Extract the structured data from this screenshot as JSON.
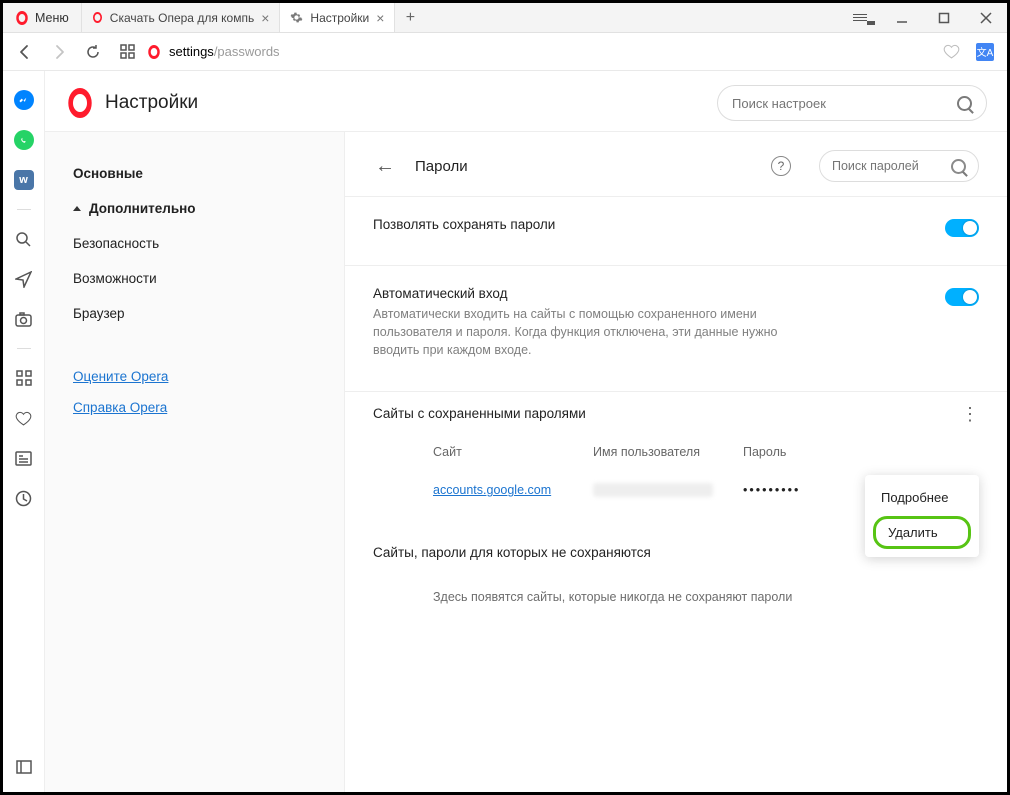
{
  "window": {
    "menu_label": "Меню",
    "tabs": [
      {
        "title": "Скачать Опера для компь",
        "active": false
      },
      {
        "title": "Настройки",
        "active": true
      }
    ]
  },
  "addressbar": {
    "prefix": "settings",
    "suffix": "/passwords"
  },
  "settings_header": {
    "title": "Настройки",
    "search_placeholder": "Поиск настроек"
  },
  "side_nav": {
    "basic": "Основные",
    "advanced": "Дополнительно",
    "security": "Безопасность",
    "features": "Возможности",
    "browser": "Браузер",
    "rate": "Оцените Opera",
    "help": "Справка Opera"
  },
  "content": {
    "page_title": "Пароли",
    "search_placeholder": "Поиск паролей",
    "allow_save_label": "Позволять сохранять пароли",
    "autosignin_title": "Автоматический вход",
    "autosignin_desc": "Автоматически входить на сайты с помощью сохраненного имени пользователя и пароля. Когда функция отключена, эти данные нужно вводить при каждом входе.",
    "saved_sites_heading": "Сайты с сохраненными паролями",
    "columns": {
      "site": "Сайт",
      "user": "Имя пользователя",
      "pass": "Пароль"
    },
    "row": {
      "site": "accounts.google.com",
      "password_mask": "•••••••••"
    },
    "menu": {
      "details": "Подробнее",
      "delete": "Удалить"
    },
    "never_heading": "Сайты, пароли для которых не сохраняются",
    "never_empty": "Здесь появятся сайты, которые никогда не сохраняют пароли"
  }
}
